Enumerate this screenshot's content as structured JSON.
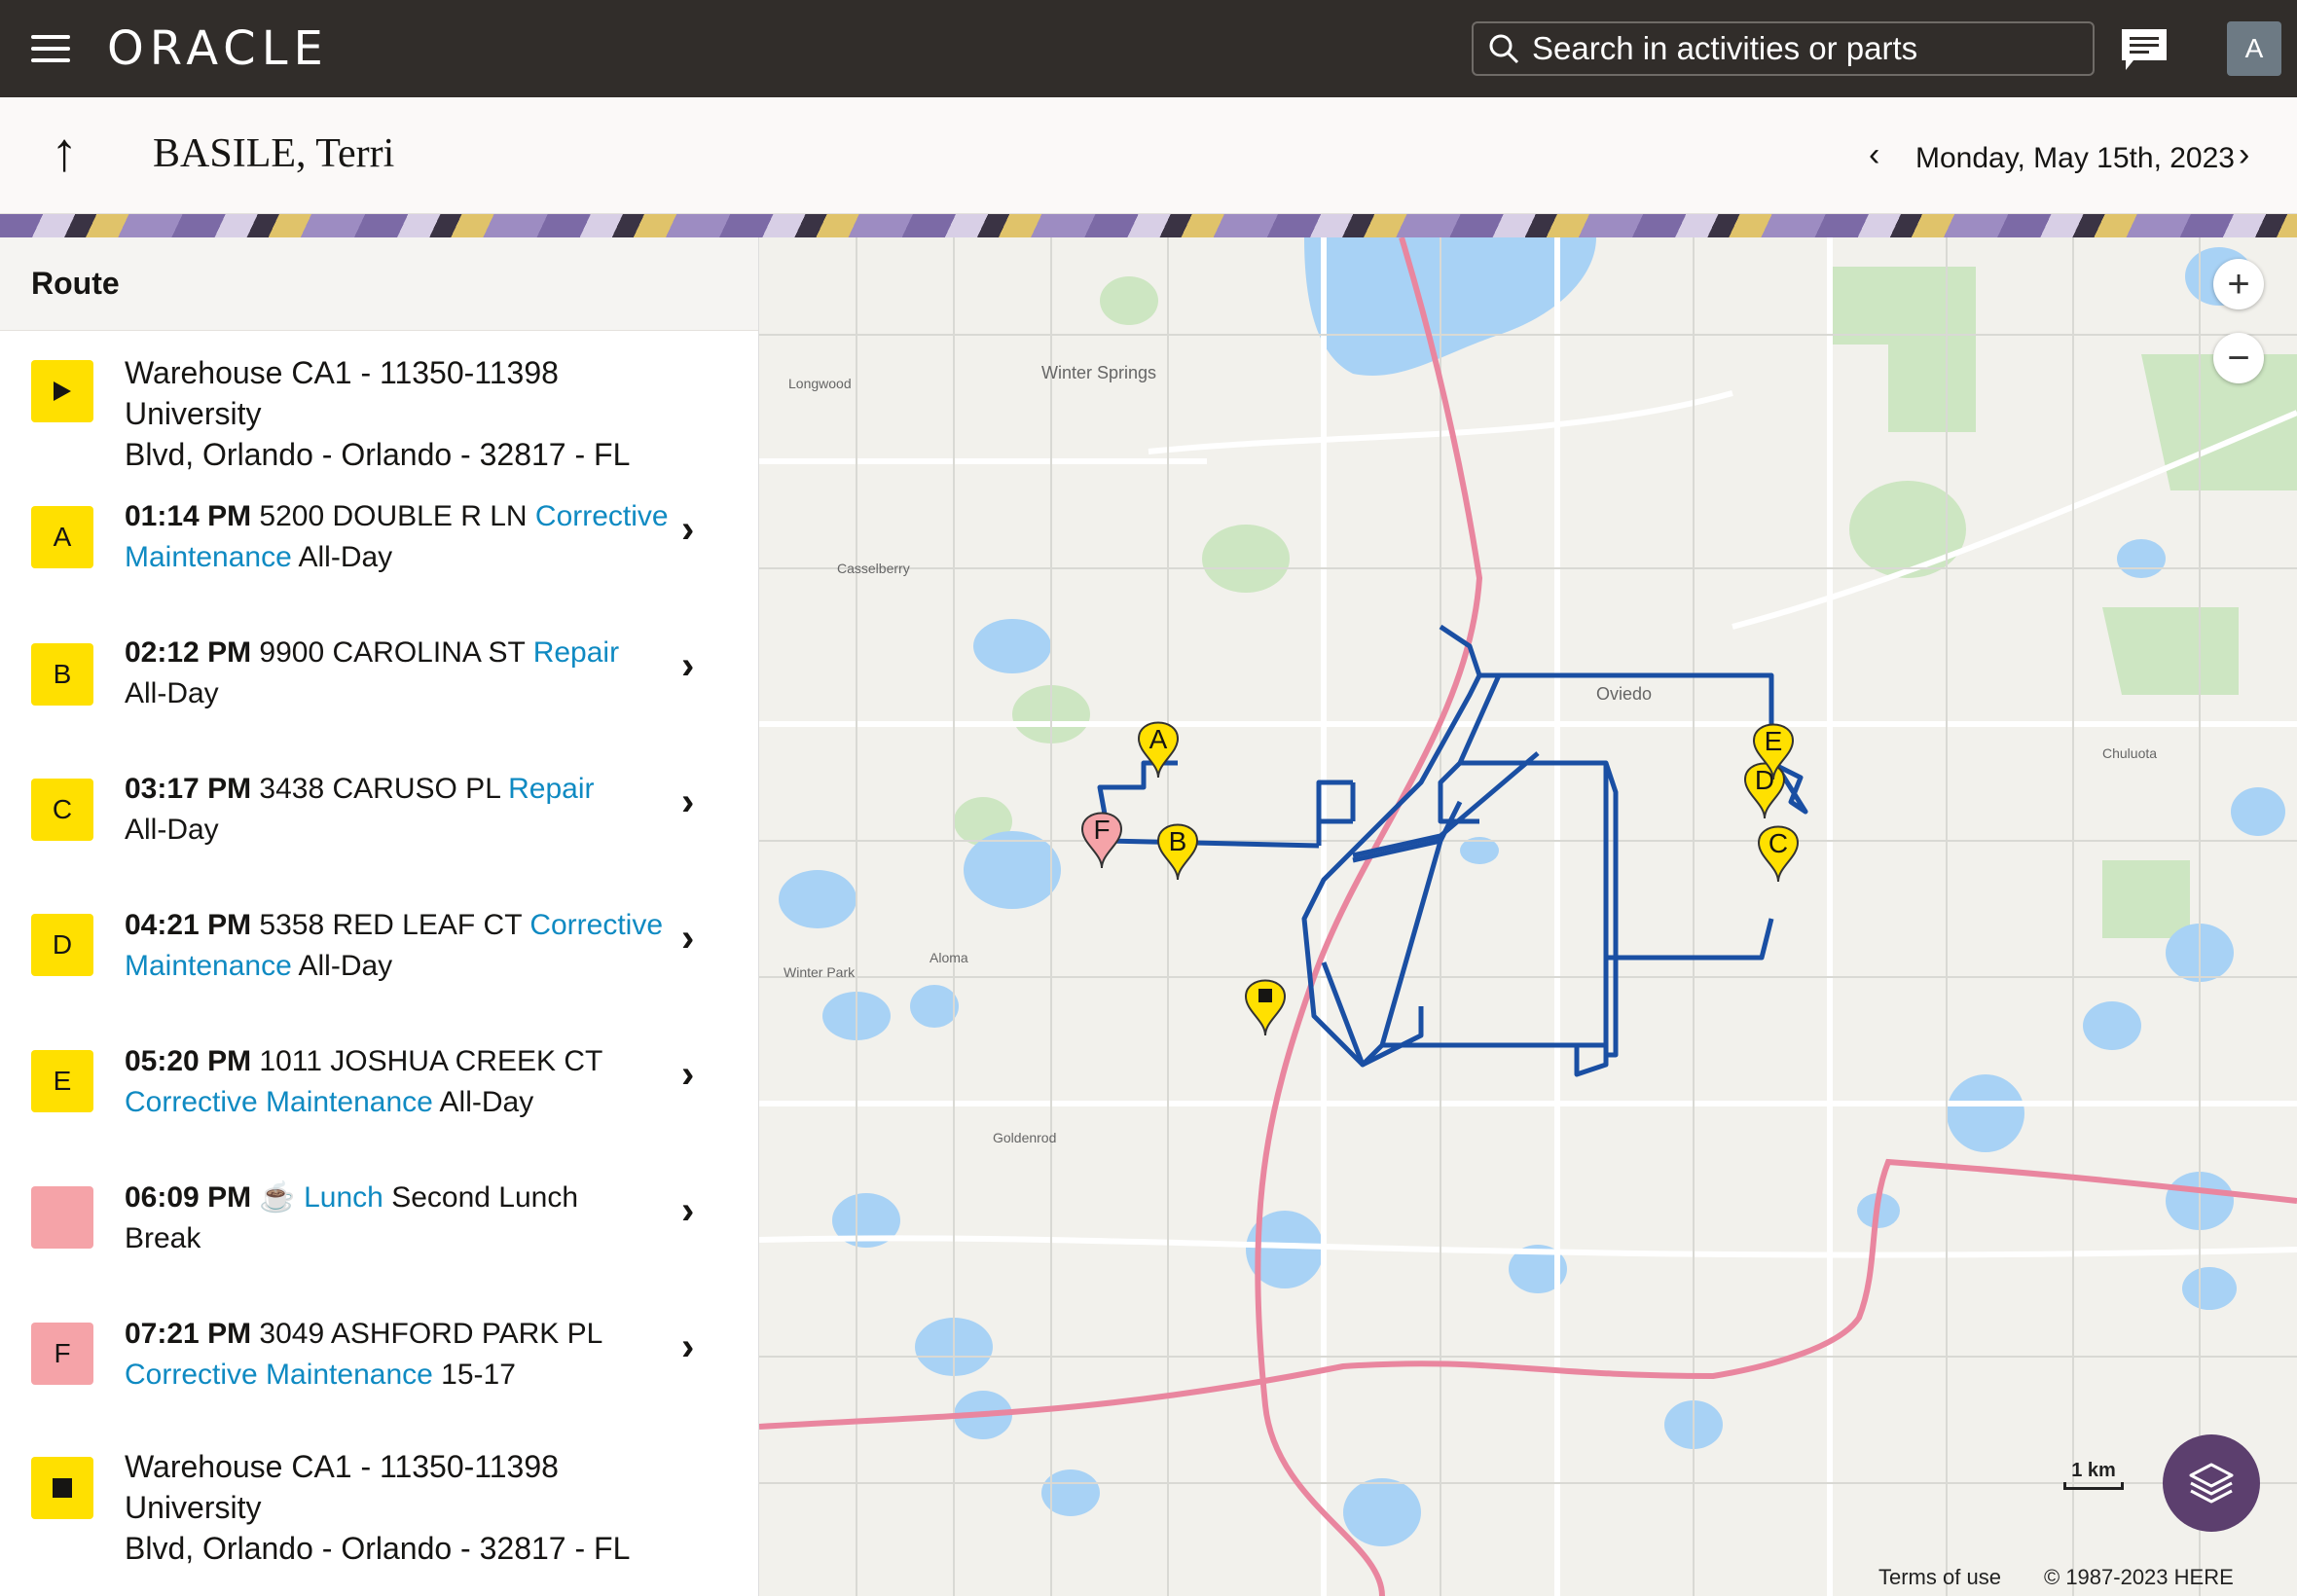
{
  "header": {
    "logo": "ORACLE",
    "search_placeholder": "Search in activities or parts",
    "avatar_initial": "A"
  },
  "subheader": {
    "technician": "BASILE, Terri",
    "date": "Monday, May 15th, 2023"
  },
  "route": {
    "title": "Route",
    "start": {
      "address_line1": "Warehouse CA1 - 11350-11398 University",
      "address_line2": "Blvd, Orlando - Orlando - 32817 - FL"
    },
    "items": [
      {
        "badge": "A",
        "color": "#ffe000",
        "time": "01:14 PM",
        "address": "5200 DOUBLE R LN",
        "type": "Corrective",
        "type2": "Maintenance",
        "duration": "All-Day"
      },
      {
        "badge": "B",
        "color": "#ffe000",
        "time": "02:12 PM",
        "address": "9900 CAROLINA ST",
        "type": "Repair",
        "type2": "",
        "duration": "All-Day"
      },
      {
        "badge": "C",
        "color": "#ffe000",
        "time": "03:17 PM",
        "address": "3438 CARUSO PL",
        "type": "Repair",
        "type2": "",
        "duration": "All-Day"
      },
      {
        "badge": "D",
        "color": "#ffe000",
        "time": "04:21 PM",
        "address": "5358 RED LEAF CT",
        "type": "Corrective",
        "type2": "Maintenance",
        "duration": "All-Day"
      },
      {
        "badge": "E",
        "color": "#ffe000",
        "time": "05:20 PM",
        "address": "1011 JOSHUA CREEK CT",
        "type": "Corrective Maintenance",
        "type2": "",
        "duration": "All-Day"
      },
      {
        "badge": "",
        "color": "#f5a3a8",
        "time": "06:09 PM",
        "address": "☕",
        "type": "Lunch",
        "type2": "",
        "duration": "Second Lunch Break"
      },
      {
        "badge": "F",
        "color": "#f5a3a8",
        "time": "07:21 PM",
        "address": "3049 ASHFORD PARK PL",
        "type": "Corrective Maintenance",
        "type2": "",
        "duration": "15-17"
      }
    ],
    "end": {
      "address_line1": "Warehouse CA1 - 11350-11398 University",
      "address_line2": "Blvd, Orlando - Orlando - 32817 - FL"
    }
  },
  "map": {
    "scale_label": "1 km",
    "terms": "Terms of use",
    "copyright": "© 1987-2023 HERE",
    "places": [
      "Winter Springs",
      "Oviedo",
      "Casselberry",
      "Longwood",
      "Chuluota",
      "Winter Park",
      "Aloma",
      "Goldenrod"
    ],
    "route_color": "#1a4fa3",
    "markers": [
      "A",
      "B",
      "C",
      "D",
      "E",
      "F"
    ]
  }
}
